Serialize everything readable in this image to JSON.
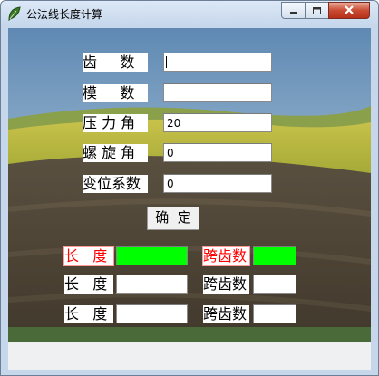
{
  "window": {
    "title": "公法线长度计算",
    "icon": "app-leaf-icon",
    "controls": {
      "minimize": "minimize-icon",
      "maximize": "maximize-icon",
      "close": "close-icon"
    }
  },
  "form": {
    "teeth": {
      "label": "齿     数",
      "value": ""
    },
    "module": {
      "label": "模     数",
      "value": ""
    },
    "pressure_angle": {
      "label": "压 力 角",
      "value": "20"
    },
    "helix_angle": {
      "label": "螺 旋 角",
      "value": "0"
    },
    "shift_coef": {
      "label": "变位系数",
      "value": "0"
    },
    "confirm_label": "确  定"
  },
  "results": [
    {
      "length_label": "长   度",
      "length_value": "",
      "span_label": "跨齿数",
      "span_value": "",
      "highlight": true
    },
    {
      "length_label": "长   度",
      "length_value": "",
      "span_label": "跨齿数",
      "span_value": "",
      "highlight": false
    },
    {
      "length_label": "长   度",
      "length_value": "",
      "span_label": "跨齿数",
      "span_value": "",
      "highlight": false
    }
  ],
  "colors": {
    "highlight_fill": "#00ff00",
    "highlight_text": "#ff0000"
  }
}
